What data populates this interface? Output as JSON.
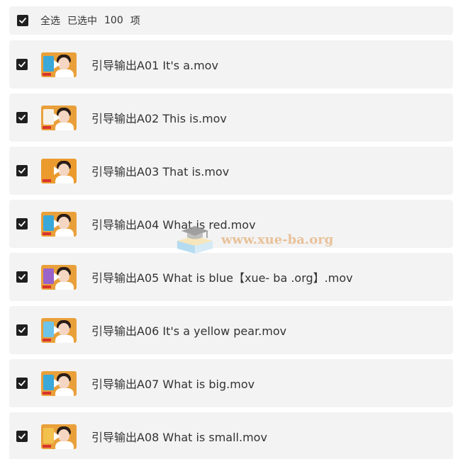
{
  "header": {
    "select_all": "全选",
    "selected_label": "已选中",
    "count": "100",
    "unit": "项"
  },
  "files": [
    {
      "name": "引导输出A01 It's a.mov",
      "thumb_color": "#e9a03a",
      "panel_color": "#3aa8d8"
    },
    {
      "name": "引导输出A02 This is.mov",
      "thumb_color": "#e9a03a",
      "panel_color": "#f6f1e8"
    },
    {
      "name": "引导输出A03 That is.mov",
      "thumb_color": "#eb9a2e",
      "panel_color": "#eb9a2e"
    },
    {
      "name": "引导输出A04 What is red.mov",
      "thumb_color": "#e9a03a",
      "panel_color": "#3aa8d8"
    },
    {
      "name": "引导输出A05 What is blue【xue- ba .org】.mov",
      "thumb_color": "#e9a03a",
      "panel_color": "#9a63c9"
    },
    {
      "name": "引导输出A06 It's a yellow pear.mov",
      "thumb_color": "#e9a03a",
      "panel_color": "#6ec3e8"
    },
    {
      "name": "引导输出A07 What is big.mov",
      "thumb_color": "#e9a03a",
      "panel_color": "#3aa8d8"
    },
    {
      "name": "引导输出A08 What is small.mov",
      "thumb_color": "#e9a03a",
      "panel_color": "#f2c14e"
    }
  ],
  "watermark": {
    "text": "www.xue-ba.org",
    "icon": "graduation-cap-book-icon"
  },
  "colors": {
    "row_bg": "#f3f3f3",
    "checkbox": "#1f1f1f",
    "text": "#333333",
    "watermark": "#e7b98a"
  }
}
